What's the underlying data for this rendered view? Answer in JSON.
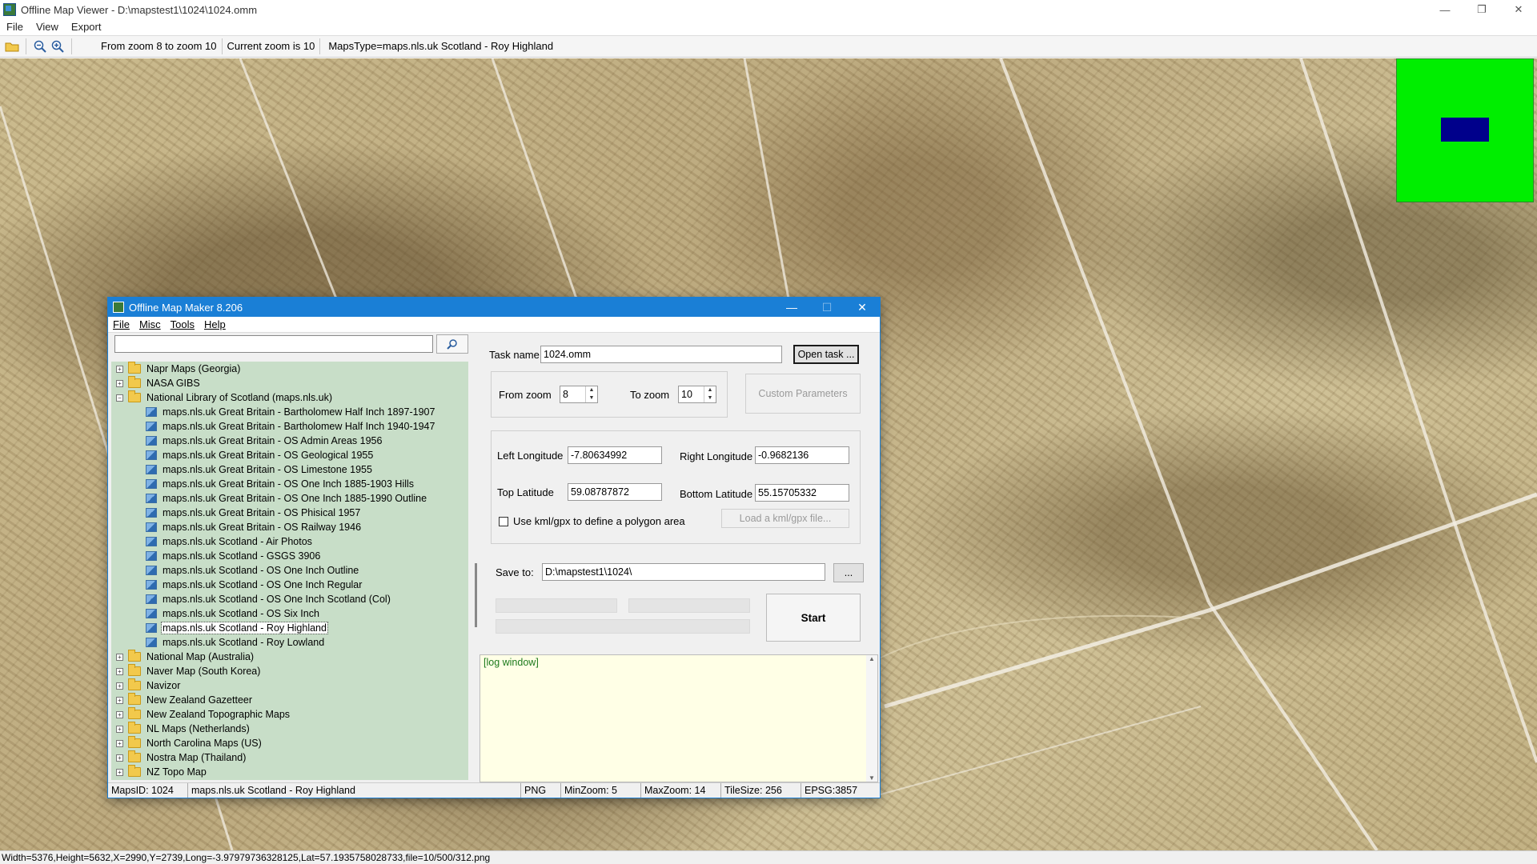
{
  "window": {
    "title": "Offline Map Viewer - D:\\mapstest1\\1024\\1024.omm",
    "controls": [
      "—",
      "❐",
      "✕"
    ]
  },
  "menu": [
    "File",
    "View",
    "Export"
  ],
  "toolbar": {
    "zoom_range": "From zoom 8 to zoom 10",
    "current_zoom": "Current zoom is 10",
    "maps_type": "MapsType=maps.nls.uk Scotland - Roy Highland"
  },
  "statusbar": {
    "text": "Width=5376,Height=5632,X=2990,Y=2739,Long=-3.97979736328125,Lat=57.1935758028733,file=10/500/312.png"
  },
  "colors": {
    "dialog_title": "#1a7fd6",
    "tree_bg": "#c8dec8",
    "log_bg": "#ffffe6",
    "minimap": "#00ee00",
    "minimap_view": "#00008b"
  },
  "dialog": {
    "title": "Offline Map Maker 8.206",
    "menu": [
      "File",
      "Misc",
      "Tools",
      "Help"
    ],
    "search": {
      "value": "",
      "icon": "search-icon"
    },
    "tree": [
      {
        "type": "folder",
        "expanded": false,
        "label": "Napr Maps (Georgia)"
      },
      {
        "type": "folder",
        "expanded": false,
        "label": "NASA GIBS"
      },
      {
        "type": "folder",
        "expanded": true,
        "label": "National Library of Scotland (maps.nls.uk)"
      },
      {
        "type": "map",
        "label": "maps.nls.uk Great Britain - Bartholomew Half Inch 1897-1907"
      },
      {
        "type": "map",
        "label": "maps.nls.uk Great Britain - Bartholomew Half Inch 1940-1947"
      },
      {
        "type": "map",
        "label": "maps.nls.uk Great Britain - OS Admin Areas 1956"
      },
      {
        "type": "map",
        "label": "maps.nls.uk Great Britain - OS Geological 1955"
      },
      {
        "type": "map",
        "label": "maps.nls.uk Great Britain - OS Limestone 1955"
      },
      {
        "type": "map",
        "label": "maps.nls.uk Great Britain - OS One Inch 1885-1903 Hills"
      },
      {
        "type": "map",
        "label": "maps.nls.uk Great Britain - OS One Inch 1885-1990 Outline"
      },
      {
        "type": "map",
        "label": "maps.nls.uk Great Britain - OS Phisical 1957"
      },
      {
        "type": "map",
        "label": "maps.nls.uk Great Britain - OS Railway 1946"
      },
      {
        "type": "map",
        "label": "maps.nls.uk Scotland - Air Photos"
      },
      {
        "type": "map",
        "label": "maps.nls.uk Scotland - GSGS 3906"
      },
      {
        "type": "map",
        "label": "maps.nls.uk Scotland - OS One Inch Outline"
      },
      {
        "type": "map",
        "label": "maps.nls.uk Scotland - OS One Inch Regular"
      },
      {
        "type": "map",
        "label": "maps.nls.uk Scotland - OS One Inch Scotland (Col)"
      },
      {
        "type": "map",
        "label": "maps.nls.uk Scotland - OS Six Inch"
      },
      {
        "type": "map",
        "label": "maps.nls.uk Scotland - Roy Highland",
        "selected": true
      },
      {
        "type": "map",
        "label": "maps.nls.uk Scotland - Roy Lowland"
      },
      {
        "type": "folder",
        "expanded": false,
        "label": "National Map (Australia)"
      },
      {
        "type": "folder",
        "expanded": false,
        "label": "Naver Map (South Korea)"
      },
      {
        "type": "folder",
        "expanded": false,
        "label": "Navizor"
      },
      {
        "type": "folder",
        "expanded": false,
        "label": "New Zealand Gazetteer"
      },
      {
        "type": "folder",
        "expanded": false,
        "label": "New Zealand Topographic Maps"
      },
      {
        "type": "folder",
        "expanded": false,
        "label": "NL Maps (Netherlands)"
      },
      {
        "type": "folder",
        "expanded": false,
        "label": "North Carolina Maps (US)"
      },
      {
        "type": "folder",
        "expanded": false,
        "label": "Nostra Map (Thailand)"
      },
      {
        "type": "folder",
        "expanded": false,
        "label": "NZ Topo Map"
      }
    ],
    "task": {
      "task_name_label": "Task name",
      "task_name_value": "1024.omm",
      "open_task": "Open task ..."
    },
    "zoom": {
      "from_label": "From zoom",
      "from_value": "8",
      "to_label": "To zoom",
      "to_value": "10",
      "custom_params": "Custom Parameters"
    },
    "bounds": {
      "left_lon_label": "Left Longitude",
      "left_lon_value": "-7.80634992",
      "right_lon_label": "Right Longitude",
      "right_lon_value": "-0.9682136",
      "top_lat_label": "Top Latitude",
      "top_lat_value": "59.08787872",
      "bottom_lat_label": "Bottom Latitude",
      "bottom_lat_value": "55.15705332",
      "kml_label": "Use kml/gpx to define a polygon area",
      "kml_checked": false,
      "load_kml": "Load a kml/gpx file..."
    },
    "save": {
      "label": "Save to:",
      "value": "D:\\mapstest1\\1024\\",
      "browse": "..."
    },
    "start": "Start",
    "log": "[log window]",
    "status": {
      "maps_id": "MapsID: 1024",
      "maps_name": "maps.nls.uk Scotland - Roy Highland",
      "format": "PNG",
      "min_zoom": "MinZoom: 5",
      "max_zoom": "MaxZoom: 14",
      "tile_size": "TileSize: 256",
      "epsg": "EPSG:3857"
    }
  }
}
